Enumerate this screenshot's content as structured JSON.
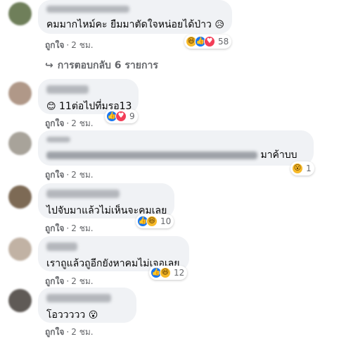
{
  "comments": [
    {
      "text": "คมมากไหม์คะ ยืมมาตัดใจหน่อยได้ป่าว",
      "text_emoji": "😥",
      "reactions": [
        "haha-icon",
        "like-icon",
        "love-icon"
      ],
      "count": "58",
      "like": "ถูกใจ",
      "time": "2 ชม."
    },
    {
      "text": "11ต่อไปที่มรอ13",
      "text_emoji": "😊",
      "reactions": [
        "like-icon",
        "love-icon"
      ],
      "count": "9",
      "like": "ถูกใจ",
      "time": "2 ชม."
    },
    {
      "text": "มาค้าบบ",
      "text_emoji": "",
      "reactions": [
        "wow-icon"
      ],
      "count": "1",
      "like": "ถูกใจ",
      "time": "2 ชม."
    },
    {
      "text": "ไปจับมาแล้วไม่เห็นจะคมเลย",
      "text_emoji": "",
      "reactions": [
        "like-icon",
        "haha-icon"
      ],
      "count": "10",
      "like": "ถูกใจ",
      "time": "2 ชม."
    },
    {
      "text": "เราถูแล้วถูอีกยังหาคมไม่เจอเลย",
      "text_emoji": "",
      "reactions": [
        "like-icon",
        "haha-icon"
      ],
      "count": "12",
      "like": "ถูกใจ",
      "time": "2 ชม."
    },
    {
      "text": "โอววววว",
      "text_emoji": "😮",
      "reactions": [],
      "count": "",
      "like": "ถูกใจ",
      "time": "2 ชม."
    }
  ],
  "replies_label": "การตอบกลับ 6 รายการ",
  "separator": "·",
  "arrow": "↪",
  "reaction_glyphs": {
    "like": "👍",
    "love": "♥",
    "haha": "😆",
    "wow": "😮"
  },
  "colors": {
    "bubble": "#f0f2f5",
    "meta": "#65676b",
    "like": "#1877f2",
    "love": "#f33e58",
    "haha": "#f7b928"
  }
}
